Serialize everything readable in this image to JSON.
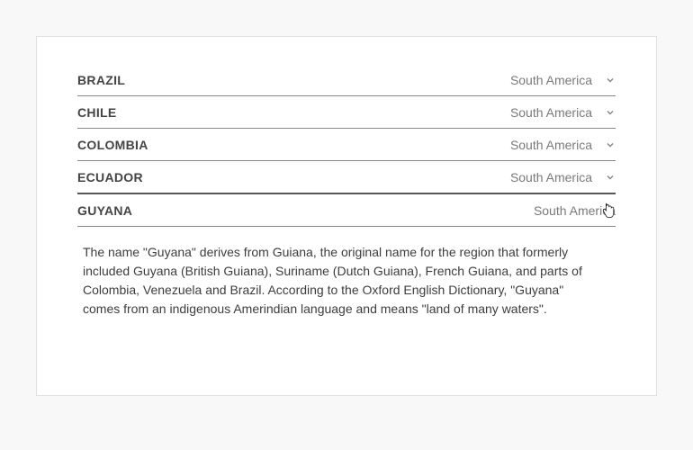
{
  "accordion": {
    "items": [
      {
        "title": "BRAZIL",
        "region": "South America",
        "expanded": false
      },
      {
        "title": "CHILE",
        "region": "South America",
        "expanded": false
      },
      {
        "title": "COLOMBIA",
        "region": "South America",
        "expanded": false
      },
      {
        "title": "ECUADOR",
        "region": "South America",
        "expanded": false
      },
      {
        "title": "GUYANA",
        "region": "South America",
        "expanded": true,
        "description": "The name \"Guyana\" derives from Guiana, the original name for the region that formerly included Guyana (British Guiana), Suriname (Dutch Guiana), French Guiana, and parts of Colombia, Venezuela and Brazil. According to the Oxford English Dictionary, \"Guyana\" comes from an indigenous Amerindian language and means \"land of many waters\"."
      }
    ]
  }
}
